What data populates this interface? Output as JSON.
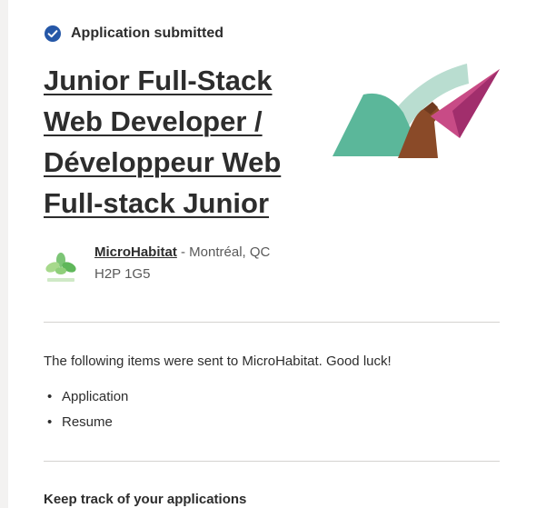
{
  "status": {
    "icon": "check-circle-icon",
    "text": "Application submitted",
    "icon_color": "#2557a7"
  },
  "job": {
    "title_lines": [
      "Junior Full-Stack",
      "Web Developer /",
      "Développeur Web",
      "Full-stack Junior"
    ]
  },
  "illustration": {
    "icon": "paper-plane-hand-illustration"
  },
  "company": {
    "logo": "microhabitat-leaf-logo",
    "name": "MicroHabitat",
    "location": " - Montréal, QC H2P 1G5"
  },
  "confirmation": {
    "message": "The following items were sent to MicroHabitat. Good luck!",
    "items": [
      "Application",
      "Resume"
    ],
    "bullet": "•"
  },
  "track": {
    "heading": "Keep track of your applications"
  }
}
